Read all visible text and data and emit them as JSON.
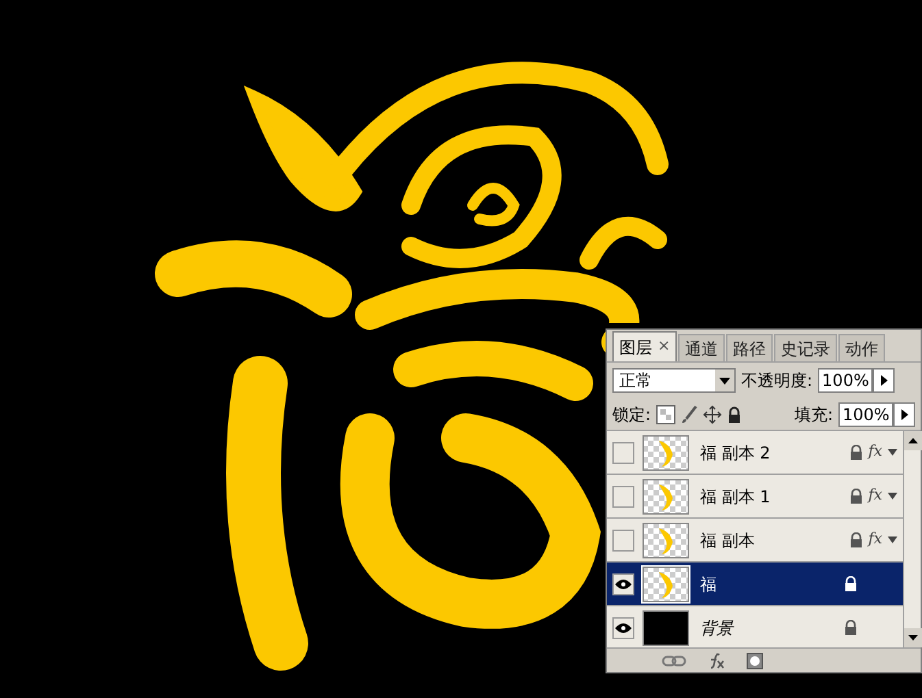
{
  "layers_panel": {
    "tabs": [
      {
        "label": "图层",
        "selected": true,
        "close": "×"
      },
      {
        "label": "通道",
        "selected": false
      },
      {
        "label": "路径",
        "selected": false
      },
      {
        "label": "史记录",
        "selected": false
      },
      {
        "label": "动作",
        "selected": false
      }
    ],
    "blend_mode": "正常",
    "opacity_label": "不透明度:",
    "opacity": "100%",
    "lock_label": "锁定:",
    "fill_label": "填充:",
    "fill": "100%",
    "layers": [
      {
        "name": "福 副本 2",
        "kind": "copy",
        "visible": false,
        "selected": false,
        "fx": "fx"
      },
      {
        "name": "福 副本 1",
        "kind": "copy",
        "visible": false,
        "selected": false,
        "fx": "fx"
      },
      {
        "name": "福 副本",
        "kind": "copy",
        "visible": false,
        "selected": false,
        "fx": "fx"
      },
      {
        "name": "福",
        "kind": "copy",
        "visible": true,
        "selected": true
      },
      {
        "name": "背景",
        "kind": "background",
        "visible": true,
        "selected": false
      }
    ]
  }
}
